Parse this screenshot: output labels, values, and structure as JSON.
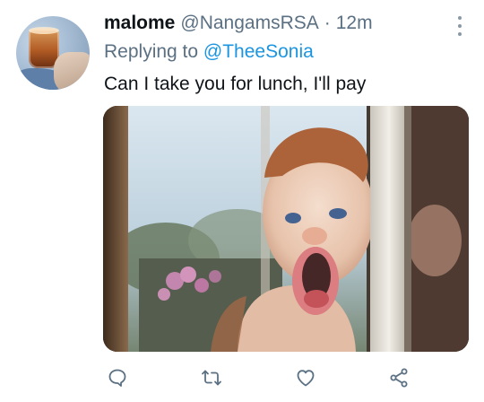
{
  "tweet": {
    "author_name": "malome",
    "author_handle": "@NangamsRSA",
    "separator": "·",
    "time": "12m",
    "replying_prefix": "Replying to",
    "replying_to": "@TheeSonia",
    "text": "Can I take you for lunch, I'll pay"
  },
  "icons": {
    "more": "more-vertical-icon",
    "reply": "reply-icon",
    "retweet": "retweet-icon",
    "like": "heart-icon",
    "share": "share-icon"
  },
  "colors": {
    "name": "#0f1419",
    "secondary": "#5b7083",
    "mention": "#1b95e0",
    "icon": "#5b7083"
  }
}
